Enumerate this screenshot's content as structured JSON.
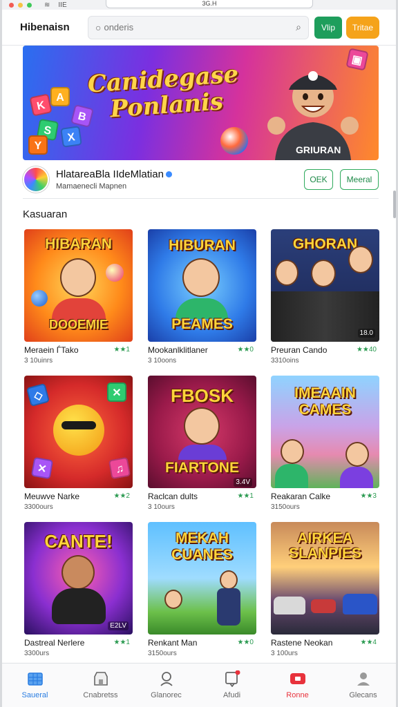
{
  "status": {
    "url": "3G.H",
    "label": "IIE"
  },
  "header": {
    "title": "Hibenaisn",
    "search_placeholder": "onderis",
    "vip_label": "Vlip",
    "tri_label": "Tritae"
  },
  "banner": {
    "title_line1": "Canidegase",
    "title_line2": "Ponlanis",
    "shirt_text": "GRIURAN"
  },
  "featured_app": {
    "name": "HlatareaBla IIdeMlatian",
    "subtitle": "Mamaenecli Mapnen",
    "ok_label": "OEK",
    "meeral_label": "Meeral"
  },
  "section": {
    "title": "Kasuaran"
  },
  "cards": [
    {
      "thumb_title": "HIBARAN",
      "thumb_caption": "DOOEMIE",
      "name": "Meraein ЃTako",
      "rating": "★★1",
      "sub": "3 10uinrs",
      "badge": ""
    },
    {
      "thumb_title": "HIBURAN",
      "thumb_caption": "PEAMES",
      "name": "Mookanlklitlaner",
      "rating": "★★0",
      "sub": "3 10oons",
      "badge": ""
    },
    {
      "thumb_title": "GHORAN",
      "thumb_caption": "",
      "name": "Preuran Cando",
      "rating": "★★40",
      "sub": "3310oins",
      "badge": "18.0"
    },
    {
      "thumb_title": "",
      "thumb_caption": "",
      "name": "Meuwve Narke",
      "rating": "★★2",
      "sub": "3300ours",
      "badge": ""
    },
    {
      "thumb_title": "FBOSK",
      "thumb_caption": "FIARTONE",
      "name": "Raclcan dults",
      "rating": "★★1",
      "sub": "3 10ours",
      "badge": "3.4V"
    },
    {
      "thumb_title": "IMEAAIN",
      "thumb_caption": "CAMES",
      "name": "Reakaran Calke",
      "rating": "★★3",
      "sub": "3150ours",
      "badge": ""
    },
    {
      "thumb_title": "CANTE!",
      "thumb_caption": "",
      "name": "Dastreal Nerlere",
      "rating": "★★1",
      "sub": "3300urs",
      "badge": "E2LV"
    },
    {
      "thumb_title": "MEKAH",
      "thumb_caption": "CUANES",
      "name": "Renkant Man",
      "rating": "★★0",
      "sub": "3150ours",
      "badge": ""
    },
    {
      "thumb_title": "AIRKEA",
      "thumb_caption": "SLANPIES",
      "name": "Rastene Neokan",
      "rating": "★★4",
      "sub": "3 100urs",
      "badge": ""
    }
  ],
  "nav": [
    {
      "label": "Saueral",
      "icon": "grid-icon"
    },
    {
      "label": "Cnabretss",
      "icon": "store-icon"
    },
    {
      "label": "Glanorec",
      "icon": "user-icon"
    },
    {
      "label": "Afudi",
      "icon": "chat-icon"
    },
    {
      "label": "Ronne",
      "icon": "play-icon"
    },
    {
      "label": "Glecans",
      "icon": "profile-icon"
    }
  ],
  "colors": {
    "accent_green": "#1e9e5c",
    "accent_orange": "#f5a31a",
    "nav_active": "#2a7de1",
    "nav_red": "#e8323c"
  }
}
